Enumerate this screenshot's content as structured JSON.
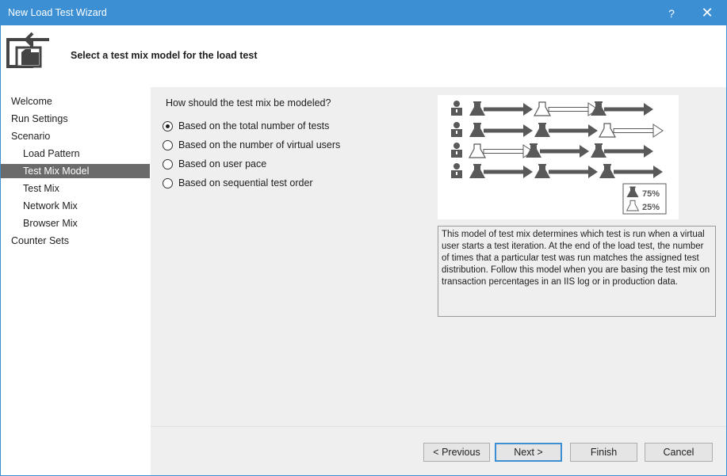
{
  "window": {
    "title": "New Load Test Wizard",
    "help_label": "?",
    "close_label": "✕"
  },
  "header": {
    "heading": "Select a test mix model for the load test"
  },
  "sidebar": {
    "items": [
      {
        "label": "Welcome",
        "level": 0,
        "selected": false
      },
      {
        "label": "Run Settings",
        "level": 0,
        "selected": false
      },
      {
        "label": "Scenario",
        "level": 0,
        "selected": false
      },
      {
        "label": "Load Pattern",
        "level": 1,
        "selected": false
      },
      {
        "label": "Test Mix Model",
        "level": 1,
        "selected": true
      },
      {
        "label": "Test Mix",
        "level": 1,
        "selected": false
      },
      {
        "label": "Network Mix",
        "level": 1,
        "selected": false
      },
      {
        "label": "Browser Mix",
        "level": 1,
        "selected": false
      },
      {
        "label": "Counter Sets",
        "level": 0,
        "selected": false
      }
    ]
  },
  "main": {
    "question": "How should the test mix be modeled?",
    "options": [
      {
        "label": "Based on the total number of tests",
        "checked": true
      },
      {
        "label": "Based on the number of virtual users",
        "checked": false
      },
      {
        "label": "Based on user pace",
        "checked": false
      },
      {
        "label": "Based on sequential test order",
        "checked": false
      }
    ],
    "illustration": {
      "legend": [
        {
          "label": "75%",
          "icon": "filled-flask-icon"
        },
        {
          "label": "25%",
          "icon": "outline-flask-icon"
        }
      ]
    },
    "description": "This model of test mix determines which test is run when a virtual user starts a test iteration. At the end of the load test, the number of times that a particular test was run matches the assigned test distribution. Follow this model when you are basing the test mix on transaction percentages in an IIS log or in production data."
  },
  "footer": {
    "previous": "< Previous",
    "next": "Next >",
    "finish": "Finish",
    "cancel": "Cancel"
  },
  "colors": {
    "title_bar": "#3c8fd2",
    "selected_nav": "#6b6b6b",
    "panel": "#efefef",
    "icon_gray": "#595959"
  }
}
